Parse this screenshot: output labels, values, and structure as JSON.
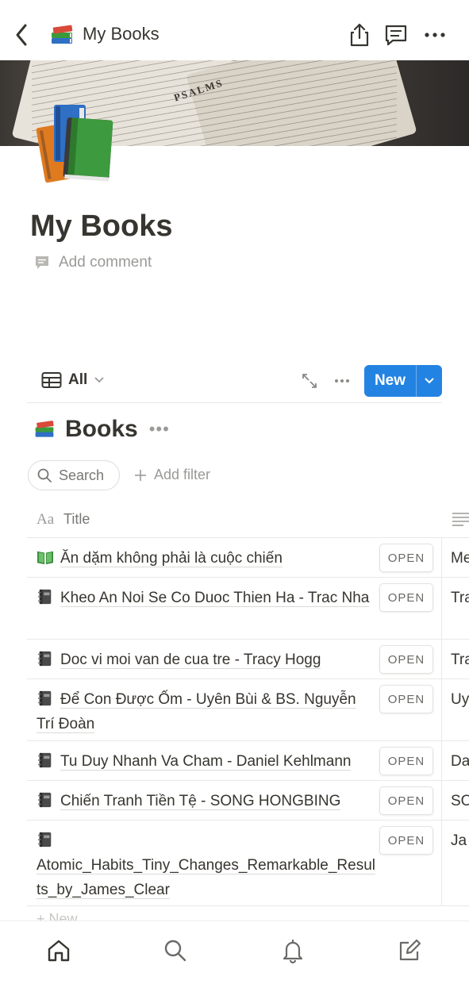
{
  "topbar": {
    "page_name": "My Books",
    "icons": [
      "back-icon",
      "books-icon",
      "share-icon",
      "comment-icon",
      "more-icon"
    ]
  },
  "cover": {
    "text": "PSALMS"
  },
  "page": {
    "title": "My Books",
    "add_comment": "Add comment"
  },
  "view": {
    "tab_label": "All",
    "new_label": "New"
  },
  "database": {
    "title": "Books",
    "search_label": "Search",
    "add_filter_label": "Add filter",
    "column_prefix": "Aa",
    "column_title": "Title",
    "new_row_label": "+ New",
    "rows": [
      {
        "icon": "open-book",
        "title": "Ăn dặm không phải là cuộc chiến",
        "open": "OPEN",
        "col2": "Me"
      },
      {
        "icon": "notebook",
        "title": "Kheo An Noi Se Co Duoc Thien Ha - Trac Nha",
        "open": "OPEN",
        "col2": "Tra"
      },
      {
        "icon": "notebook",
        "title": "Doc vi moi van de cua tre - Tracy Hogg",
        "open": "OPEN",
        "col2": "Tra"
      },
      {
        "icon": "notebook",
        "title": "Để Con Được Ốm - Uyên Bùi & BS. Nguyễn Trí Đoàn",
        "open": "OPEN",
        "col2": "Uy"
      },
      {
        "icon": "notebook",
        "title": "Tu Duy Nhanh Va Cham - Daniel Kehlmann",
        "open": "OPEN",
        "col2": "Da"
      },
      {
        "icon": "notebook",
        "title": "Chiến Tranh Tiền Tệ - SONG HONGBING",
        "open": "OPEN",
        "col2": "SO"
      },
      {
        "icon": "notebook",
        "title": "Atomic_Habits_Tiny_Changes_Remarkable_Results_by_James_Clear",
        "open": "OPEN",
        "col2": "Ja"
      }
    ]
  },
  "bottom_nav": [
    "home-icon",
    "search-icon",
    "bell-icon",
    "compose-icon"
  ],
  "colors": {
    "accent": "#2383e2",
    "text": "#37352f",
    "muted": "#9b9a97"
  }
}
